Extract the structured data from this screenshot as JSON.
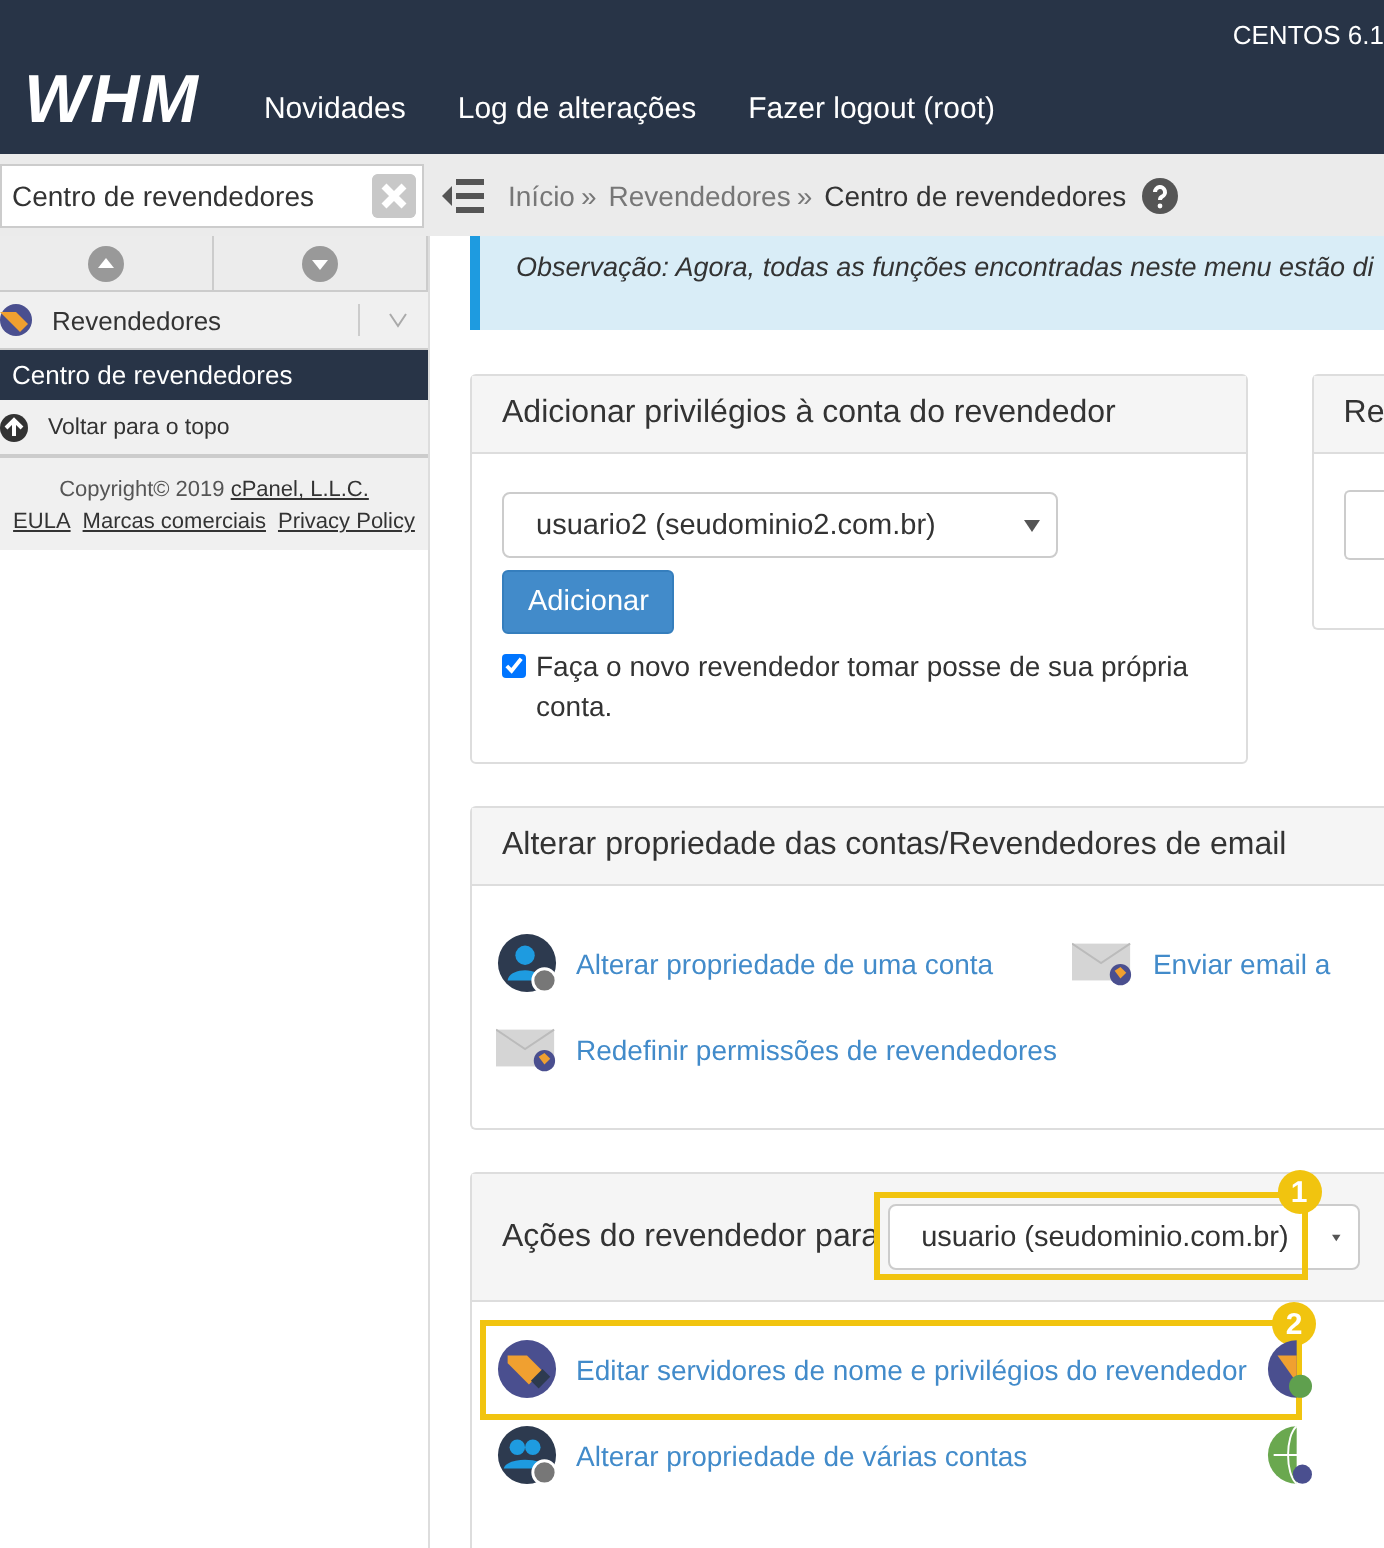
{
  "header": {
    "logo": "WHM",
    "os": "CENTOS 6.1",
    "nav": [
      "Novidades",
      "Log de alterações",
      "Fazer logout (root)"
    ]
  },
  "search": {
    "value": "Centro de revendedores"
  },
  "breadcrumb": [
    {
      "label": "Início",
      "current": false,
      "separator": "»"
    },
    {
      "label": "Revendedores",
      "current": false,
      "separator": "»"
    },
    {
      "label": "Centro de revendedores",
      "current": true
    }
  ],
  "sidebar": {
    "group": {
      "label": "Revendedores",
      "expanded": false
    },
    "items": [
      {
        "label": "Centro de revendedores",
        "selected": true
      }
    ],
    "back": "Voltar para o topo",
    "copyright": "Copyright© 2019 ",
    "company": "cPanel, L.L.C.",
    "links": [
      "EULA",
      "Marcas comerciais",
      "Privacy Policy"
    ]
  },
  "note": "Observação: Agora, todas as funções encontradas neste menu estão di",
  "add_panel": {
    "title": "Adicionar privilégios à conta do revendedor",
    "select": "usuario2 (seudominio2.com.br)",
    "button": "Adicionar",
    "checkbox": {
      "label": "Faça o novo revendedor tomar posse de sua própria conta.",
      "checked": true
    }
  },
  "side_panel": {
    "title": "Re"
  },
  "ownership_panel": {
    "title": "Alterar propriedade das contas/Revendedores de email",
    "links": [
      {
        "label": "Alterar propriedade de uma conta",
        "kind": "user"
      },
      {
        "label": "Enviar email a",
        "kind": "mail"
      },
      {
        "label": "Redefinir permissões de revendedores",
        "kind": "mail"
      }
    ]
  },
  "actions_panel": {
    "title": "Ações do revendedor para",
    "select": "usuario (seudominio.com.br)",
    "select_badge": "1",
    "links": [
      {
        "label": "Editar servidores de nome e privilégios do revendedor",
        "kind": "tag",
        "badge": "2"
      },
      {
        "kind": "tagip"
      },
      {
        "label": "Alterar propriedade de várias contas",
        "kind": "users"
      },
      {
        "kind": "globe"
      }
    ]
  }
}
